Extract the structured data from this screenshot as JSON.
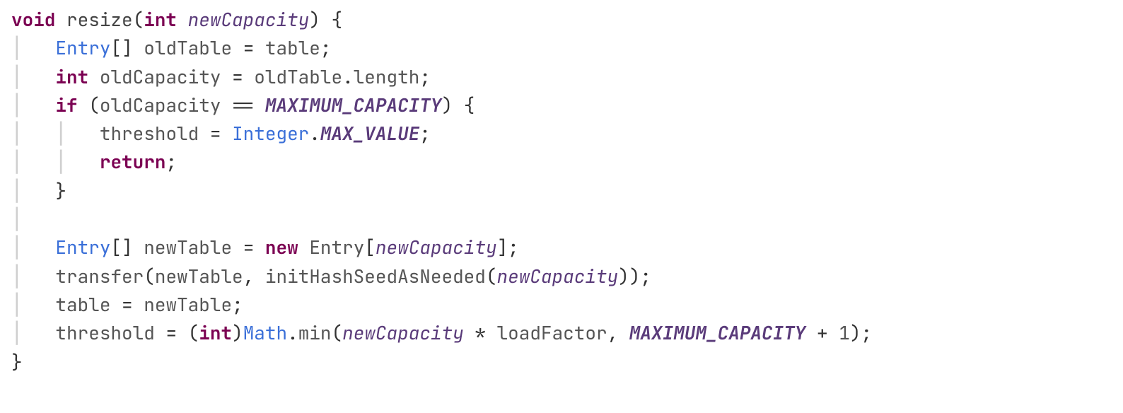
{
  "tokens": {
    "kw_void": "void",
    "fn_resize": "resize",
    "kw_int": "int",
    "p_newCapacity": "newCapacity",
    "lbrace": "{",
    "rbrace": "}",
    "lparen": "(",
    "rparen": ")",
    "lbrack": "[",
    "rbrack": "]",
    "semi": ";",
    "comma": ",",
    "dot": ".",
    "assign": "=",
    "eqeq": "==",
    "star": "*",
    "plus": "+",
    "t_Entry": "Entry",
    "id_oldTable": "oldTable",
    "id_table": "table",
    "id_oldCapacity": "oldCapacity",
    "id_length": "length",
    "kw_if": "if",
    "c_MAXCAP": "MAXIMUM_CAPACITY",
    "id_threshold": "threshold",
    "t_Integer": "Integer",
    "c_MAXVAL": "MAX_VALUE",
    "kw_return": "return",
    "id_newTable": "newTable",
    "kw_new": "new",
    "fn_transfer": "transfer",
    "fn_initHashSeed": "initHashSeedAsNeeded",
    "t_Math": "Math",
    "fn_min": "min",
    "id_loadFactor": "loadFactor",
    "lit_1": "1"
  }
}
